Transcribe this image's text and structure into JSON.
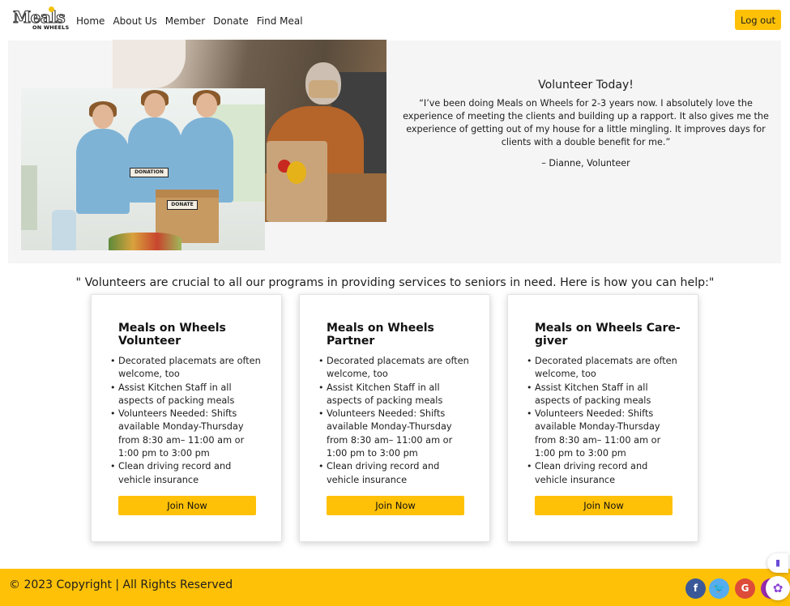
{
  "nav": {
    "logo_text": "Meals",
    "logo_sub": "ON WHEELS",
    "links": [
      {
        "label": "Home"
      },
      {
        "label": "About Us"
      },
      {
        "label": "Member"
      },
      {
        "label": "Donate"
      },
      {
        "label": "Find Meal"
      }
    ],
    "logout_label": "Log out"
  },
  "hero": {
    "photo_signs": [
      "DONATION",
      "DONATE"
    ],
    "heading": "Volunteer Today!",
    "quote": "“I’ve been doing Meals on Wheels for 2-3 years now. I absolutely love the experience of meeting the clients and building up a rapport. It also gives me the experience of getting out of my house for a little mingling. It improves days for clients with a double benefit for me.”",
    "author": "– Dianne, Volunteer"
  },
  "intro": "\" Volunteers are crucial to all our programs in providing services to seniors in need. Here is how you can help:\"",
  "cards": [
    {
      "title": "Meals on Wheels Volunteer",
      "items": [
        "Decorated placemats are often welcome, too",
        "Assist Kitchen Staff in all aspects of packing meals",
        "Volunteers Needed: Shifts available Monday-Thursday from 8:30 am– 11:00 am or 1:00 pm to 3:00 pm",
        "Clean driving record and vehicle insurance"
      ],
      "button": "Join Now"
    },
    {
      "title": "Meals on Wheels Partner",
      "items": [
        "Decorated placemats are often welcome, too",
        "Assist Kitchen Staff in all aspects of packing meals",
        "Volunteers Needed: Shifts available Monday-Thursday from 8:30 am– 11:00 am or 1:00 pm to 3:00 pm",
        "Clean driving record and vehicle insurance"
      ],
      "button": "Join Now"
    },
    {
      "title": "Meals on Wheels Care-giver",
      "items": [
        "Decorated placemats are often welcome, too",
        "Assist Kitchen Staff in all aspects of packing meals",
        "Volunteers Needed: Shifts available Monday-Thursday from 8:30 am– 11:00 am or 1:00 pm to 3:00 pm",
        "Clean driving record and vehicle insurance"
      ],
      "button": "Join Now"
    }
  ],
  "footer": {
    "copyright": "© 2023 Copyright | All Rights Reserved",
    "social": [
      {
        "icon": "facebook-icon",
        "glyph": "f",
        "color": "#3b5998"
      },
      {
        "icon": "twitter-icon",
        "glyph": "🐦",
        "color": "#55acee"
      },
      {
        "icon": "google-icon",
        "glyph": "G",
        "color": "#dd4b39"
      },
      {
        "icon": "instagram-icon",
        "glyph": "◎",
        "color": "#9a2bb0"
      }
    ]
  },
  "colors": {
    "accent": "#ffc107",
    "hero_bg": "#f5f5f6"
  }
}
